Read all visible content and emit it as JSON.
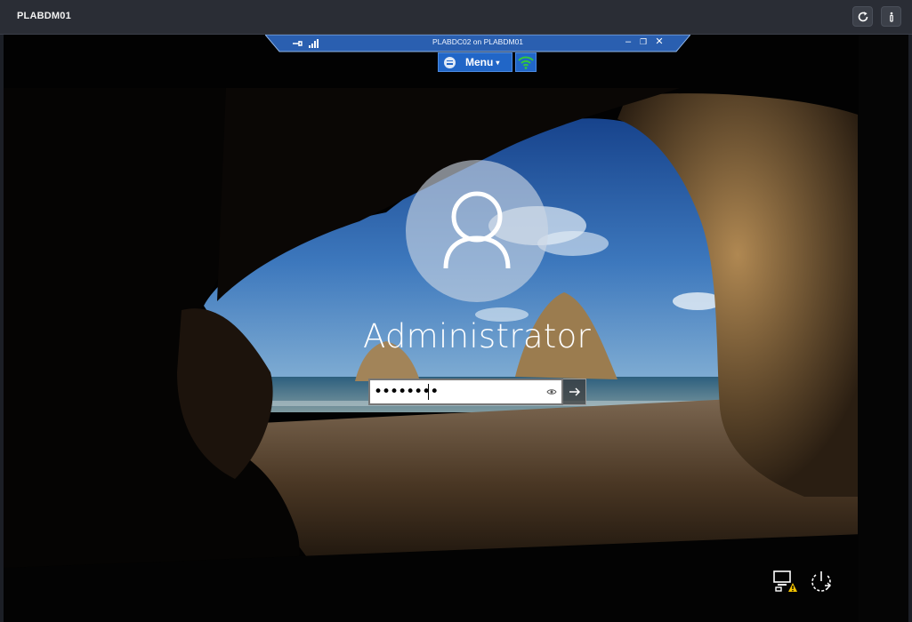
{
  "host": {
    "title": "PLABDM01",
    "buttons": [
      {
        "icon": "refresh-icon"
      },
      {
        "icon": "info-icon"
      }
    ]
  },
  "rdp_bar": {
    "title": "PLABDC02 on PLABDM01",
    "controls": [
      "minimize-icon",
      "restore-icon",
      "close-icon"
    ],
    "left_icons": [
      "pin-icon",
      "signal-icon"
    ]
  },
  "toolbar": {
    "menu_label": "Menu",
    "wifi_icon": "wifi-icon"
  },
  "login": {
    "username": "Administrator",
    "password_mask": "••••••••",
    "reveal_icon": "eye-icon",
    "submit_icon": "arrow-right-icon"
  },
  "system_icons": [
    "network-warning-icon",
    "power-icon"
  ],
  "colors": {
    "host_bar": "#2a2d35",
    "rdp_bar_blue": "#2166c7",
    "wifi_green": "#35c83c",
    "warning_yellow": "#f5c400"
  }
}
